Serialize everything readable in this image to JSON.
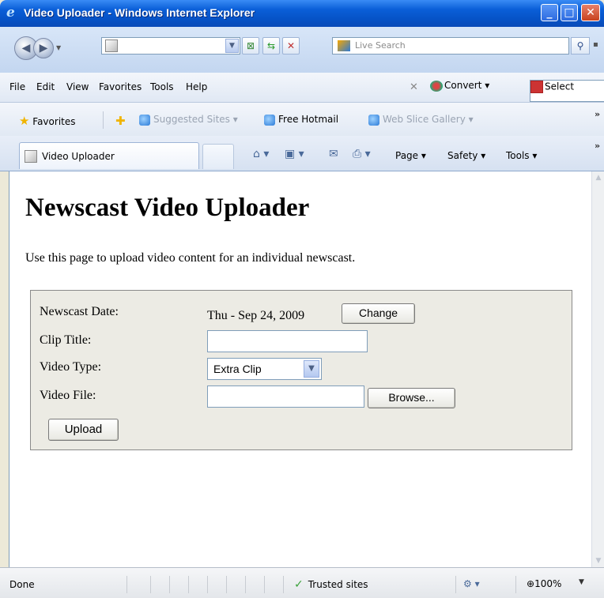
{
  "window": {
    "title": "Video Uploader - Windows Internet Explorer"
  },
  "toolbar": {
    "search_placeholder": "Live Search"
  },
  "menu": {
    "items": [
      "File",
      "Edit",
      "View",
      "Favorites",
      "Tools",
      "Help"
    ],
    "convert_label": "Convert",
    "select_label": "Select"
  },
  "favorites_bar": {
    "favorites_label": "Favorites",
    "suggested_sites": "Suggested Sites",
    "free_hotmail": "Free Hotmail",
    "web_slice_gallery": "Web Slice Gallery"
  },
  "tabs": {
    "active_tab_label": "Video Uploader",
    "page_menu": "Page",
    "safety_menu": "Safety",
    "tools_menu": "Tools"
  },
  "page": {
    "heading": "Newscast Video Uploader",
    "intro": "Use this page to upload video content for an individual newscast."
  },
  "form": {
    "date_label": "Newscast Date:",
    "date_value": "Thu - Sep 24, 2009",
    "change_button": "Change",
    "clip_title_label": "Clip Title:",
    "clip_title_value": "",
    "video_type_label": "Video Type:",
    "video_type_selected": "Extra Clip",
    "video_file_label": "Video File:",
    "video_file_value": "",
    "browse_button": "Browse...",
    "upload_button": "Upload"
  },
  "status": {
    "left": "Done",
    "zone": "Trusted sites",
    "zoom": "100%"
  }
}
